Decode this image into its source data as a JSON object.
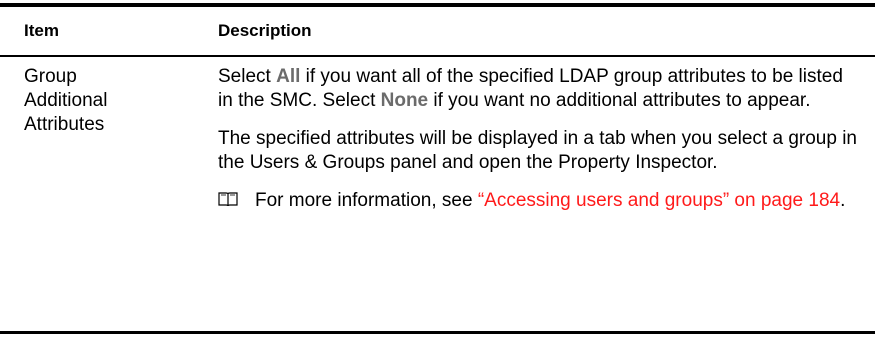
{
  "header": {
    "item_label": "Item",
    "description_label": "Description"
  },
  "row": {
    "item_lines": [
      "Group",
      "Additional",
      "Attributes"
    ],
    "p1": {
      "before_all": "Select ",
      "all": "All",
      "after_all": " if you want all of the specified LDAP group attributes to be listed in the SMC. Select ",
      "none": "None",
      "after_none": " if you want no additional attributes to appear."
    },
    "p2": "The specified attributes will be displayed in a tab when you select a group in the Users & Groups panel and open the Property Inspector.",
    "p3": {
      "prefix": "For more information, see ",
      "link_text": "“Accessing users and groups” on page 184",
      "suffix": "."
    }
  },
  "colors": {
    "keyword": "#6b6b6b",
    "link": "#ff1a1a",
    "rule": "#000000"
  },
  "icons": {
    "note": "book-icon"
  }
}
